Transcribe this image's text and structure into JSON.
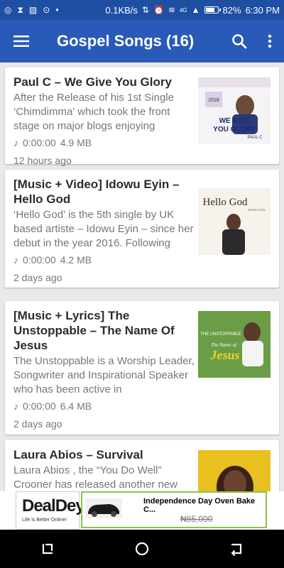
{
  "status_bar": {
    "speed": "0.1KB/s",
    "network_label": "4G",
    "battery": "82%",
    "battery_level": 0.82,
    "time": "6:30 PM"
  },
  "app_bar": {
    "title": "Gospel Songs (16)",
    "menu_icon": "hamburger-icon",
    "search_icon": "search-icon",
    "more_icon": "more-vert-icon",
    "color": "#2a5ab8"
  },
  "posts": [
    {
      "title": "Paul C – We Give You Glory",
      "excerpt": "After the Release of his 1st Single ‘Chimdimma’ which took the front stage on major blogs enjoying",
      "duration": "0:00:00",
      "size": "4.9 MB",
      "time": "12 hours ago",
      "thumb": {
        "year": "2018",
        "line1": "WE GIVE",
        "line2": "YOU GLORY",
        "artist": "PAUL C"
      }
    },
    {
      "title": "[Music + Video] Idowu Eyin – Hello God",
      "excerpt": "‘Hello God’  is the 5th single by UK based artiste –  Idowu Eyin  – since her debut in the year 2016. Following",
      "duration": "0:00:00",
      "size": "4.2 MB",
      "time": "2 days ago",
      "thumb": {
        "line1": "Hello God",
        "artist": "IDOWU EYIN"
      }
    },
    {
      "title": "[Music + Lyrics] The Unstoppable – The Name Of Jesus",
      "excerpt": "The Unstoppable  is a Worship Leader, Songwriter and Inspirational Speaker who has been active in",
      "duration": "0:00:00",
      "size": "6.4 MB",
      "time": "2 days ago",
      "thumb": {
        "line1": "THE UNSTOPPABLE",
        "line2": "The Name of",
        "line3": "Jesus"
      }
    },
    {
      "title": "Laura Abios – Survival",
      "excerpt": "Laura Abios , the “You Do Well” Crooner has released another new",
      "duration": "",
      "size": "",
      "time": "",
      "thumb": {}
    }
  ],
  "ad": {
    "brand": "DealDey",
    "tagline": "Life is Better Online!",
    "product": "Independence Day Oven Bake C...",
    "price": "₦85,000",
    "border_color": "#8bc34a"
  },
  "nav_bar": {
    "back_icon": "back-icon",
    "home_icon": "home-icon",
    "recents_icon": "recents-icon"
  }
}
